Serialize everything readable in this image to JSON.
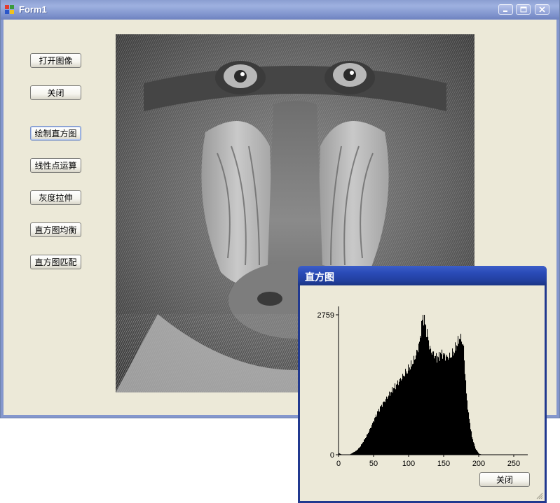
{
  "main_window": {
    "title": "Form1",
    "buttons": [
      {
        "label": "打开图像"
      },
      {
        "label": "关闭"
      },
      {
        "label": "绘制直方图"
      },
      {
        "label": "线性点运算"
      },
      {
        "label": "灰度拉伸"
      },
      {
        "label": "直方图均衡"
      },
      {
        "label": "直方图匹配"
      }
    ],
    "image_subject": "grayscale mandrill face photo"
  },
  "histogram_dialog": {
    "title": "直方图",
    "close_label": "关闭",
    "colors": {
      "bars": "#000000",
      "titlebar": "#22409f",
      "background": "#ece9d8"
    }
  },
  "chart_data": {
    "type": "bar",
    "title": "",
    "xlabel": "",
    "ylabel": "",
    "xlim": [
      0,
      270
    ],
    "ylim": [
      0,
      2759
    ],
    "xticks": [
      0,
      50,
      100,
      150,
      200,
      250
    ],
    "yticks": [
      0,
      2759
    ],
    "ytick_labels": [
      "0",
      "2759"
    ],
    "x": [
      0,
      5,
      10,
      15,
      20,
      25,
      30,
      35,
      40,
      45,
      50,
      55,
      60,
      65,
      70,
      75,
      80,
      85,
      90,
      95,
      100,
      105,
      110,
      115,
      118,
      120,
      122,
      125,
      128,
      130,
      133,
      135,
      138,
      140,
      143,
      145,
      148,
      150,
      155,
      160,
      165,
      170,
      172,
      175,
      178,
      180,
      182,
      185,
      190,
      195,
      200,
      205,
      210
    ],
    "values": [
      30,
      0,
      0,
      0,
      40,
      80,
      150,
      260,
      380,
      520,
      680,
      830,
      950,
      1050,
      1150,
      1250,
      1340,
      1430,
      1520,
      1610,
      1700,
      1800,
      1960,
      2200,
      2550,
      2759,
      2650,
      2450,
      2250,
      2080,
      2020,
      1980,
      1940,
      1910,
      1940,
      1980,
      2000,
      1950,
      1920,
      1940,
      2060,
      2220,
      2300,
      2280,
      2100,
      1650,
      1200,
      800,
      350,
      120,
      20,
      0,
      0
    ]
  }
}
